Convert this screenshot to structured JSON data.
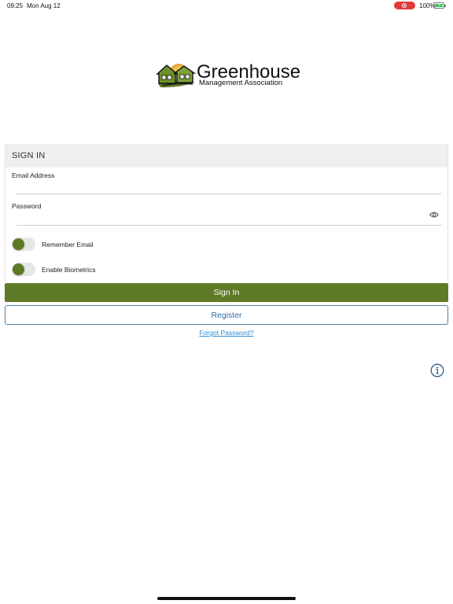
{
  "status_bar": {
    "time": "09:25",
    "date": "Mon Aug 12",
    "battery_percent": "100%",
    "recording": true,
    "colors": {
      "record": "#e03b3b",
      "battery": "#34c759"
    }
  },
  "logo": {
    "title": "Greenhouse",
    "subtitle": "Management Association"
  },
  "signin": {
    "header": "SIGN IN",
    "email": {
      "label": "Email Address",
      "value": "",
      "placeholder": ""
    },
    "password": {
      "label": "Password",
      "value": "",
      "placeholder": "",
      "reveal_icon": "eye-icon"
    },
    "toggles": [
      {
        "label": "Remember Email",
        "on": true
      },
      {
        "label": "Enable Biometrics",
        "on": true
      }
    ]
  },
  "actions": {
    "sign_in_label": "Sign In",
    "register_label": "Register",
    "forgot_password_label": "Forgot Password?"
  },
  "misc": {
    "info_icon": "info-icon"
  },
  "colors": {
    "primary_green": "#5f7a27",
    "register_blue": "#2f6ea3",
    "link_blue": "#2f8ad0",
    "header_gray": "#efefef"
  }
}
